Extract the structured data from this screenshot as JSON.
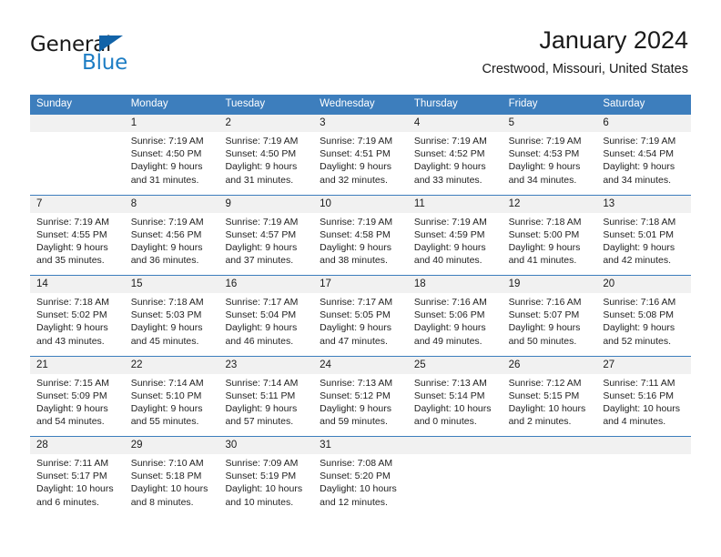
{
  "brand": {
    "name_top": "General",
    "name_bottom": "Blue",
    "color_dark": "#1a1a1a",
    "color_blue": "#1d7dc4",
    "triangle_color": "#1263a8"
  },
  "header": {
    "title": "January 2024",
    "subtitle": "Crestwood, Missouri, United States"
  },
  "theme": {
    "header_row_bg": "#3d7ebd",
    "header_row_text": "#ffffff",
    "date_band_bg": "#f1f1f1",
    "row_divider": "#3d7ebd",
    "page_bg": "#ffffff",
    "body_text": "#222222"
  },
  "weekdays": [
    "Sunday",
    "Monday",
    "Tuesday",
    "Wednesday",
    "Thursday",
    "Friday",
    "Saturday"
  ],
  "weeks": [
    [
      {
        "day": "",
        "sunrise": "",
        "sunset": "",
        "daylight_line1": "",
        "daylight_line2": ""
      },
      {
        "day": "1",
        "sunrise": "Sunrise: 7:19 AM",
        "sunset": "Sunset: 4:50 PM",
        "daylight_line1": "Daylight: 9 hours",
        "daylight_line2": "and 31 minutes."
      },
      {
        "day": "2",
        "sunrise": "Sunrise: 7:19 AM",
        "sunset": "Sunset: 4:50 PM",
        "daylight_line1": "Daylight: 9 hours",
        "daylight_line2": "and 31 minutes."
      },
      {
        "day": "3",
        "sunrise": "Sunrise: 7:19 AM",
        "sunset": "Sunset: 4:51 PM",
        "daylight_line1": "Daylight: 9 hours",
        "daylight_line2": "and 32 minutes."
      },
      {
        "day": "4",
        "sunrise": "Sunrise: 7:19 AM",
        "sunset": "Sunset: 4:52 PM",
        "daylight_line1": "Daylight: 9 hours",
        "daylight_line2": "and 33 minutes."
      },
      {
        "day": "5",
        "sunrise": "Sunrise: 7:19 AM",
        "sunset": "Sunset: 4:53 PM",
        "daylight_line1": "Daylight: 9 hours",
        "daylight_line2": "and 34 minutes."
      },
      {
        "day": "6",
        "sunrise": "Sunrise: 7:19 AM",
        "sunset": "Sunset: 4:54 PM",
        "daylight_line1": "Daylight: 9 hours",
        "daylight_line2": "and 34 minutes."
      }
    ],
    [
      {
        "day": "7",
        "sunrise": "Sunrise: 7:19 AM",
        "sunset": "Sunset: 4:55 PM",
        "daylight_line1": "Daylight: 9 hours",
        "daylight_line2": "and 35 minutes."
      },
      {
        "day": "8",
        "sunrise": "Sunrise: 7:19 AM",
        "sunset": "Sunset: 4:56 PM",
        "daylight_line1": "Daylight: 9 hours",
        "daylight_line2": "and 36 minutes."
      },
      {
        "day": "9",
        "sunrise": "Sunrise: 7:19 AM",
        "sunset": "Sunset: 4:57 PM",
        "daylight_line1": "Daylight: 9 hours",
        "daylight_line2": "and 37 minutes."
      },
      {
        "day": "10",
        "sunrise": "Sunrise: 7:19 AM",
        "sunset": "Sunset: 4:58 PM",
        "daylight_line1": "Daylight: 9 hours",
        "daylight_line2": "and 38 minutes."
      },
      {
        "day": "11",
        "sunrise": "Sunrise: 7:19 AM",
        "sunset": "Sunset: 4:59 PM",
        "daylight_line1": "Daylight: 9 hours",
        "daylight_line2": "and 40 minutes."
      },
      {
        "day": "12",
        "sunrise": "Sunrise: 7:18 AM",
        "sunset": "Sunset: 5:00 PM",
        "daylight_line1": "Daylight: 9 hours",
        "daylight_line2": "and 41 minutes."
      },
      {
        "day": "13",
        "sunrise": "Sunrise: 7:18 AM",
        "sunset": "Sunset: 5:01 PM",
        "daylight_line1": "Daylight: 9 hours",
        "daylight_line2": "and 42 minutes."
      }
    ],
    [
      {
        "day": "14",
        "sunrise": "Sunrise: 7:18 AM",
        "sunset": "Sunset: 5:02 PM",
        "daylight_line1": "Daylight: 9 hours",
        "daylight_line2": "and 43 minutes."
      },
      {
        "day": "15",
        "sunrise": "Sunrise: 7:18 AM",
        "sunset": "Sunset: 5:03 PM",
        "daylight_line1": "Daylight: 9 hours",
        "daylight_line2": "and 45 minutes."
      },
      {
        "day": "16",
        "sunrise": "Sunrise: 7:17 AM",
        "sunset": "Sunset: 5:04 PM",
        "daylight_line1": "Daylight: 9 hours",
        "daylight_line2": "and 46 minutes."
      },
      {
        "day": "17",
        "sunrise": "Sunrise: 7:17 AM",
        "sunset": "Sunset: 5:05 PM",
        "daylight_line1": "Daylight: 9 hours",
        "daylight_line2": "and 47 minutes."
      },
      {
        "day": "18",
        "sunrise": "Sunrise: 7:16 AM",
        "sunset": "Sunset: 5:06 PM",
        "daylight_line1": "Daylight: 9 hours",
        "daylight_line2": "and 49 minutes."
      },
      {
        "day": "19",
        "sunrise": "Sunrise: 7:16 AM",
        "sunset": "Sunset: 5:07 PM",
        "daylight_line1": "Daylight: 9 hours",
        "daylight_line2": "and 50 minutes."
      },
      {
        "day": "20",
        "sunrise": "Sunrise: 7:16 AM",
        "sunset": "Sunset: 5:08 PM",
        "daylight_line1": "Daylight: 9 hours",
        "daylight_line2": "and 52 minutes."
      }
    ],
    [
      {
        "day": "21",
        "sunrise": "Sunrise: 7:15 AM",
        "sunset": "Sunset: 5:09 PM",
        "daylight_line1": "Daylight: 9 hours",
        "daylight_line2": "and 54 minutes."
      },
      {
        "day": "22",
        "sunrise": "Sunrise: 7:14 AM",
        "sunset": "Sunset: 5:10 PM",
        "daylight_line1": "Daylight: 9 hours",
        "daylight_line2": "and 55 minutes."
      },
      {
        "day": "23",
        "sunrise": "Sunrise: 7:14 AM",
        "sunset": "Sunset: 5:11 PM",
        "daylight_line1": "Daylight: 9 hours",
        "daylight_line2": "and 57 minutes."
      },
      {
        "day": "24",
        "sunrise": "Sunrise: 7:13 AM",
        "sunset": "Sunset: 5:12 PM",
        "daylight_line1": "Daylight: 9 hours",
        "daylight_line2": "and 59 minutes."
      },
      {
        "day": "25",
        "sunrise": "Sunrise: 7:13 AM",
        "sunset": "Sunset: 5:14 PM",
        "daylight_line1": "Daylight: 10 hours",
        "daylight_line2": "and 0 minutes."
      },
      {
        "day": "26",
        "sunrise": "Sunrise: 7:12 AM",
        "sunset": "Sunset: 5:15 PM",
        "daylight_line1": "Daylight: 10 hours",
        "daylight_line2": "and 2 minutes."
      },
      {
        "day": "27",
        "sunrise": "Sunrise: 7:11 AM",
        "sunset": "Sunset: 5:16 PM",
        "daylight_line1": "Daylight: 10 hours",
        "daylight_line2": "and 4 minutes."
      }
    ],
    [
      {
        "day": "28",
        "sunrise": "Sunrise: 7:11 AM",
        "sunset": "Sunset: 5:17 PM",
        "daylight_line1": "Daylight: 10 hours",
        "daylight_line2": "and 6 minutes."
      },
      {
        "day": "29",
        "sunrise": "Sunrise: 7:10 AM",
        "sunset": "Sunset: 5:18 PM",
        "daylight_line1": "Daylight: 10 hours",
        "daylight_line2": "and 8 minutes."
      },
      {
        "day": "30",
        "sunrise": "Sunrise: 7:09 AM",
        "sunset": "Sunset: 5:19 PM",
        "daylight_line1": "Daylight: 10 hours",
        "daylight_line2": "and 10 minutes."
      },
      {
        "day": "31",
        "sunrise": "Sunrise: 7:08 AM",
        "sunset": "Sunset: 5:20 PM",
        "daylight_line1": "Daylight: 10 hours",
        "daylight_line2": "and 12 minutes."
      },
      {
        "day": "",
        "sunrise": "",
        "sunset": "",
        "daylight_line1": "",
        "daylight_line2": ""
      },
      {
        "day": "",
        "sunrise": "",
        "sunset": "",
        "daylight_line1": "",
        "daylight_line2": ""
      },
      {
        "day": "",
        "sunrise": "",
        "sunset": "",
        "daylight_line1": "",
        "daylight_line2": ""
      }
    ]
  ]
}
